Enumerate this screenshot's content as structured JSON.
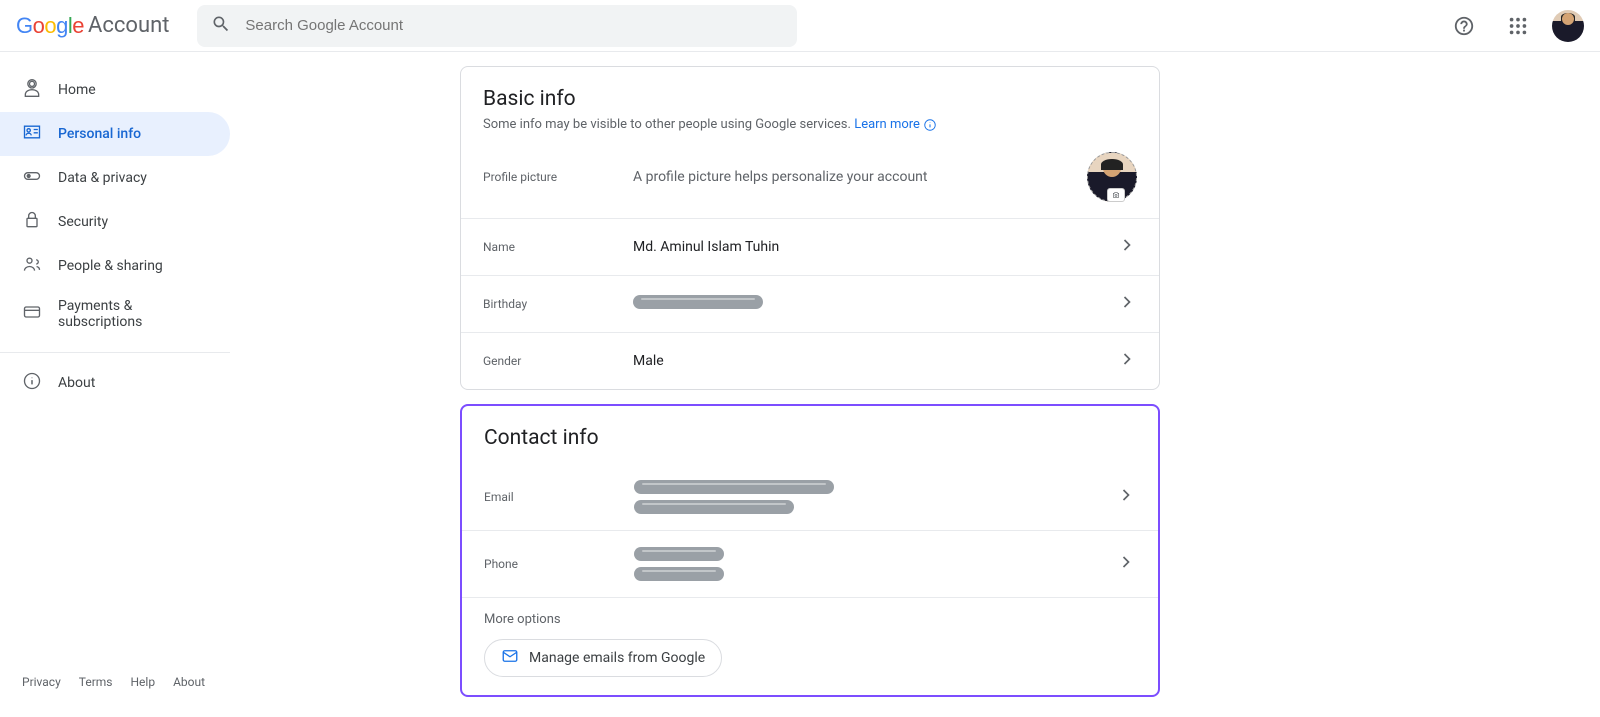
{
  "header": {
    "product": "Account",
    "search_placeholder": "Search Google Account"
  },
  "sidebar": {
    "items": [
      {
        "label": "Home"
      },
      {
        "label": "Personal info"
      },
      {
        "label": "Data & privacy"
      },
      {
        "label": "Security"
      },
      {
        "label": "People & sharing"
      },
      {
        "label": "Payments & subscriptions"
      },
      {
        "label": "About"
      }
    ]
  },
  "basic_info": {
    "title": "Basic info",
    "subtitle": "Some info may be visible to other people using Google services. ",
    "learn_more": "Learn more",
    "photo_label": "Profile picture",
    "photo_desc": "A profile picture helps personalize your account",
    "name_label": "Name",
    "name_value": "Md. Aminul Islam Tuhin",
    "birthday_label": "Birthday",
    "gender_label": "Gender",
    "gender_value": "Male"
  },
  "contact_info": {
    "title": "Contact info",
    "email_label": "Email",
    "phone_label": "Phone",
    "more_options": "More options",
    "manage_emails": "Manage emails from Google"
  },
  "footer": {
    "privacy": "Privacy",
    "terms": "Terms",
    "help": "Help",
    "about": "About"
  }
}
